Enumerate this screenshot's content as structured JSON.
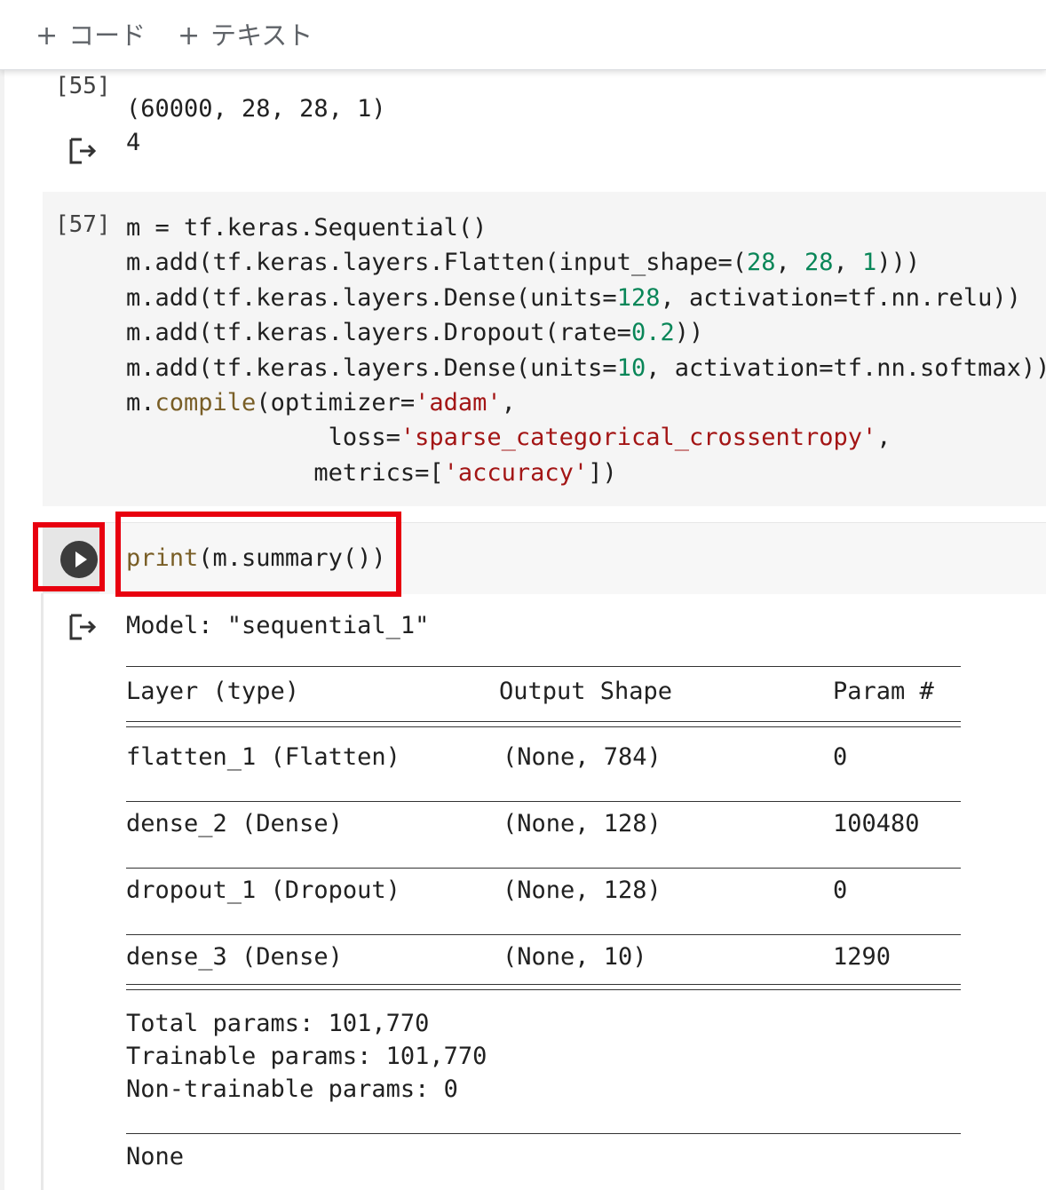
{
  "toolbar": {
    "add_code_label": "コード",
    "add_text_label": "テキスト",
    "plus_glyph": "+"
  },
  "cell55": {
    "exec_count": "[55]",
    "output_lines": [
      "(60000, 28, 28, 1)",
      "4"
    ]
  },
  "cell57": {
    "exec_count": "[57]",
    "lines": [
      [
        {
          "t": "m = tf.keras.Sequential()",
          "c": ""
        }
      ],
      [
        {
          "t": "m.add(tf.keras.layers.Flatten(input_shape=(",
          "c": ""
        },
        {
          "t": "28",
          "c": "num"
        },
        {
          "t": ", ",
          "c": ""
        },
        {
          "t": "28",
          "c": "num"
        },
        {
          "t": ", ",
          "c": ""
        },
        {
          "t": "1",
          "c": "num"
        },
        {
          "t": ")))",
          "c": ""
        }
      ],
      [
        {
          "t": "m.add(tf.keras.layers.Dense(units=",
          "c": ""
        },
        {
          "t": "128",
          "c": "num"
        },
        {
          "t": ", activation=tf.nn.relu))",
          "c": ""
        }
      ],
      [
        {
          "t": "m.add(tf.keras.layers.Dropout(rate=",
          "c": ""
        },
        {
          "t": "0.2",
          "c": "num"
        },
        {
          "t": "))",
          "c": ""
        }
      ],
      [
        {
          "t": "m.add(tf.keras.layers.Dense(units=",
          "c": ""
        },
        {
          "t": "10",
          "c": "num"
        },
        {
          "t": ", activation=tf.nn.softmax))",
          "c": ""
        }
      ],
      [
        {
          "t": "m.",
          "c": ""
        },
        {
          "t": "compile",
          "c": "fn"
        },
        {
          "t": "(optimizer=",
          "c": ""
        },
        {
          "t": "'adam'",
          "c": "str"
        },
        {
          "t": ",",
          "c": ""
        }
      ],
      [
        {
          "t": "              loss=",
          "c": ""
        },
        {
          "t": "'sparse_categorical_crossentropy'",
          "c": "str"
        },
        {
          "t": ",",
          "c": ""
        }
      ],
      [
        {
          "t": "             metrics=[",
          "c": ""
        },
        {
          "t": "'accuracy'",
          "c": "str"
        },
        {
          "t": "])",
          "c": ""
        }
      ]
    ]
  },
  "cell_active": {
    "code": [
      {
        "t": "print",
        "c": "fn"
      },
      {
        "t": "(m.summary())",
        "c": ""
      }
    ],
    "model_line": "Model: \"sequential_1\"",
    "headers": {
      "layer": "Layer (type)",
      "shape": "Output Shape",
      "params": "Param #"
    },
    "rows": [
      {
        "layer": "flatten_1 (Flatten)",
        "shape": "(None, 784)",
        "params": "0"
      },
      {
        "layer": "dense_2 (Dense)",
        "shape": "(None, 128)",
        "params": "100480"
      },
      {
        "layer": "dropout_1 (Dropout)",
        "shape": "(None, 128)",
        "params": "0"
      },
      {
        "layer": "dense_3 (Dense)",
        "shape": "(None, 10)",
        "params": "1290"
      }
    ],
    "total_params": "Total params: 101,770",
    "trainable_params": "Trainable params: 101,770",
    "non_trainable_params": "Non-trainable params: 0",
    "return_value": "None"
  },
  "icons": {
    "output": "output-arrow-icon",
    "run": "play-icon"
  },
  "colors": {
    "number": "#098658",
    "string": "#a31515",
    "function": "#795e26",
    "highlight": "#e8000f",
    "cell_bg": "#f5f5f5"
  }
}
